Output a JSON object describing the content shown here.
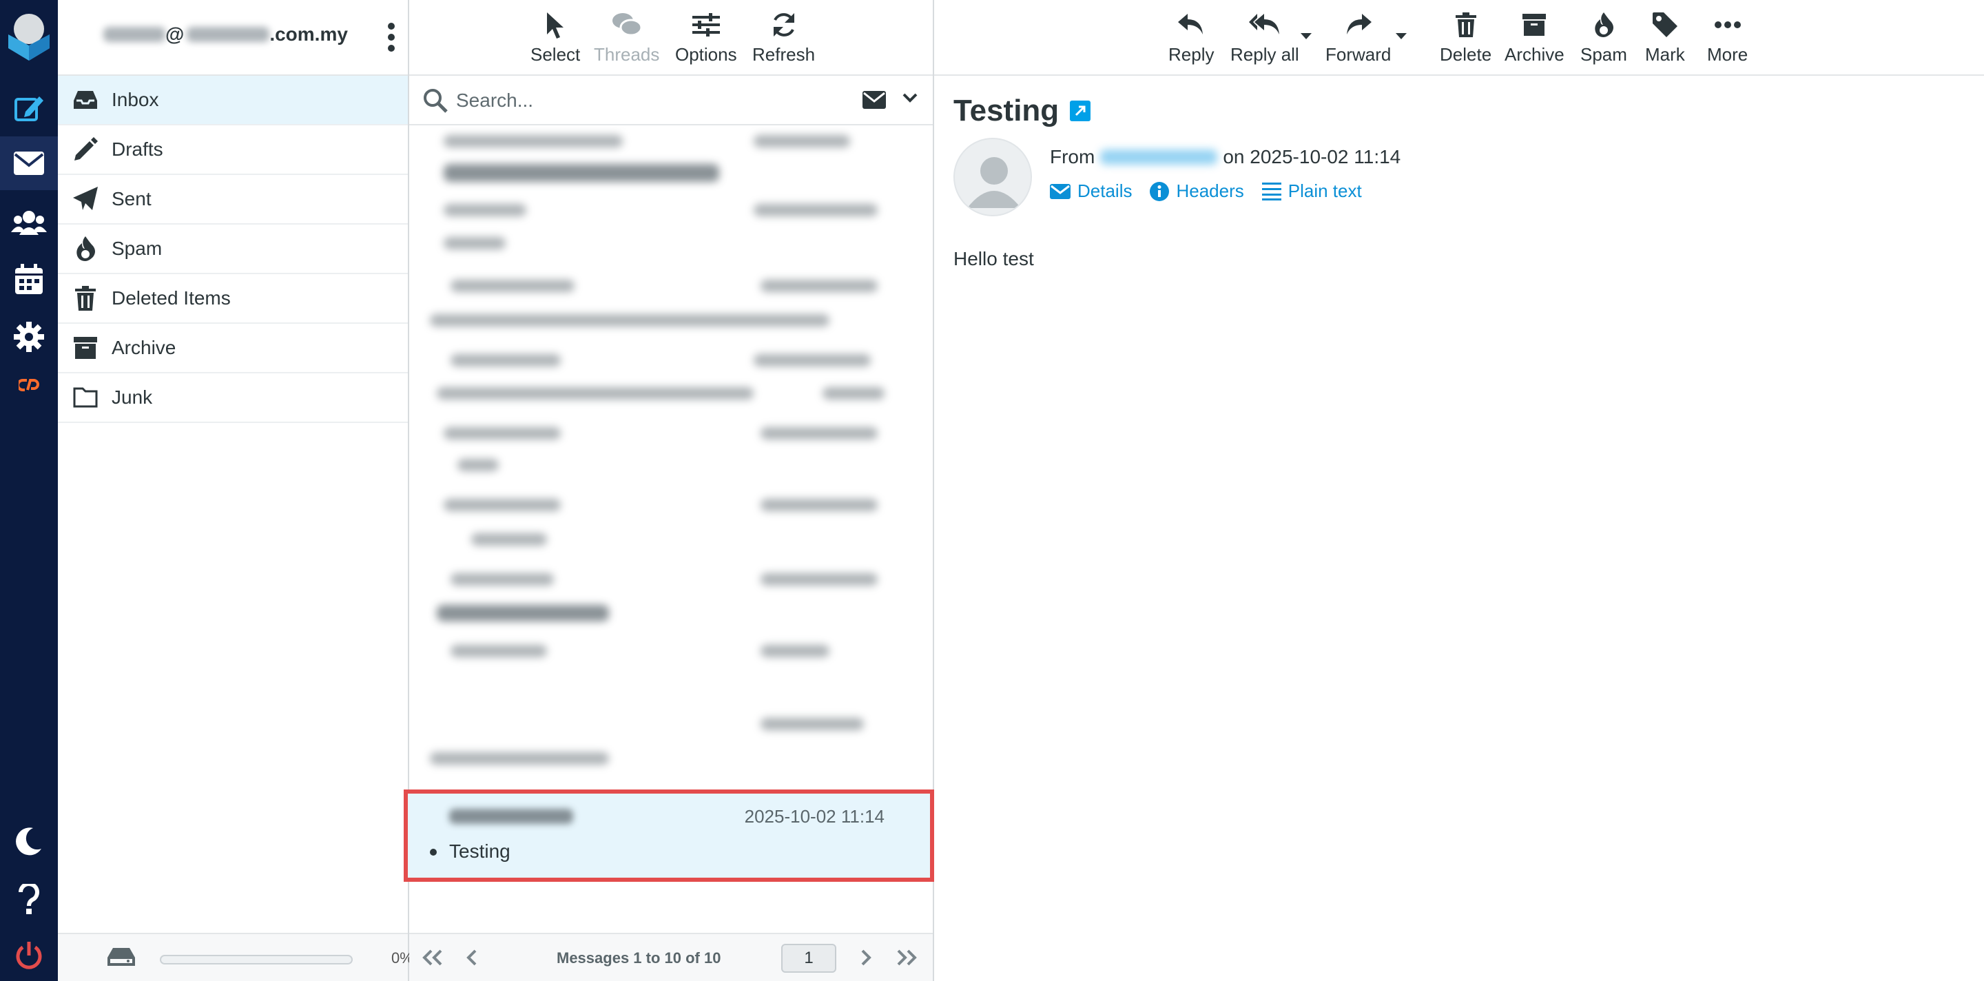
{
  "account": {
    "email_suffix": "@",
    "domain_suffix": ".com.my"
  },
  "folders": [
    {
      "label": "Inbox",
      "icon": "inbox-icon",
      "selected": true
    },
    {
      "label": "Drafts",
      "icon": "pencil-icon"
    },
    {
      "label": "Sent",
      "icon": "paper-plane-icon"
    },
    {
      "label": "Spam",
      "icon": "fire-icon"
    },
    {
      "label": "Deleted Items",
      "icon": "trash-icon"
    },
    {
      "label": "Archive",
      "icon": "archive-icon"
    },
    {
      "label": "Junk",
      "icon": "folder-icon"
    }
  ],
  "quota": {
    "percent_label": "0%",
    "percent": 0
  },
  "list_toolbar": {
    "select": "Select",
    "threads": "Threads",
    "options": "Options",
    "refresh": "Refresh"
  },
  "search": {
    "placeholder": "Search..."
  },
  "selected_message": {
    "date": "2025-10-02 11:14",
    "subject": "Testing"
  },
  "pager": {
    "count": "Messages 1 to 10 of 10",
    "page": "1"
  },
  "reader_toolbar": {
    "reply": "Reply",
    "reply_all": "Reply all",
    "forward": "Forward",
    "delete": "Delete",
    "archive": "Archive",
    "spam": "Spam",
    "mark": "Mark",
    "more": "More"
  },
  "message": {
    "subject": "Testing",
    "from_label": "From",
    "date_text": "on 2025-10-02 11:14",
    "details": "Details",
    "headers": "Headers",
    "plain_text": "Plain text",
    "body": "Hello test"
  },
  "colors": {
    "nav_bg": "#0b1b3f",
    "accent": "#00a0e8",
    "highlight": "#e34c4c",
    "selected_bg": "#e6f5fc"
  }
}
